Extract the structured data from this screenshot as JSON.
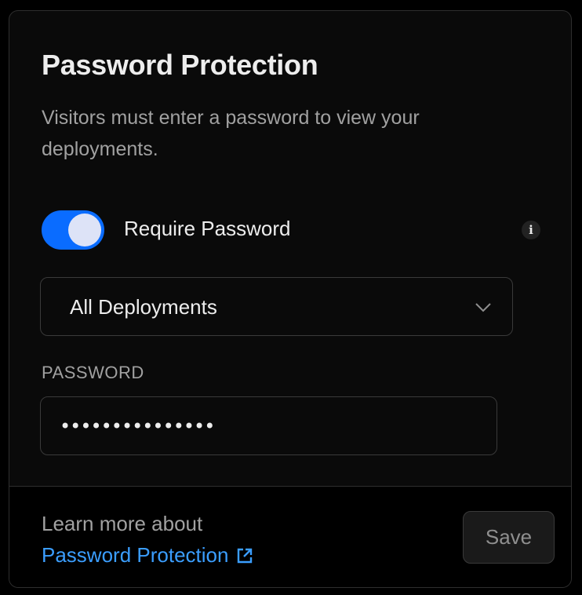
{
  "card": {
    "title": "Password Protection",
    "description": "Visitors must enter a password to view your deployments."
  },
  "toggle": {
    "label": "Require Password",
    "enabled": true,
    "info_icon": "info-icon"
  },
  "scope_select": {
    "value": "All Deployments",
    "icon": "chevron-down-icon"
  },
  "password_field": {
    "label": "PASSWORD",
    "value": "•••••••••••••••"
  },
  "footer": {
    "text": "Learn more about",
    "link_label": "Password Protection",
    "link_icon": "external-link-icon",
    "save_label": "Save"
  },
  "colors": {
    "accent": "#0a6cff",
    "link": "#3b9eff",
    "background": "#0a0a0a",
    "border": "#2e2e2e"
  }
}
